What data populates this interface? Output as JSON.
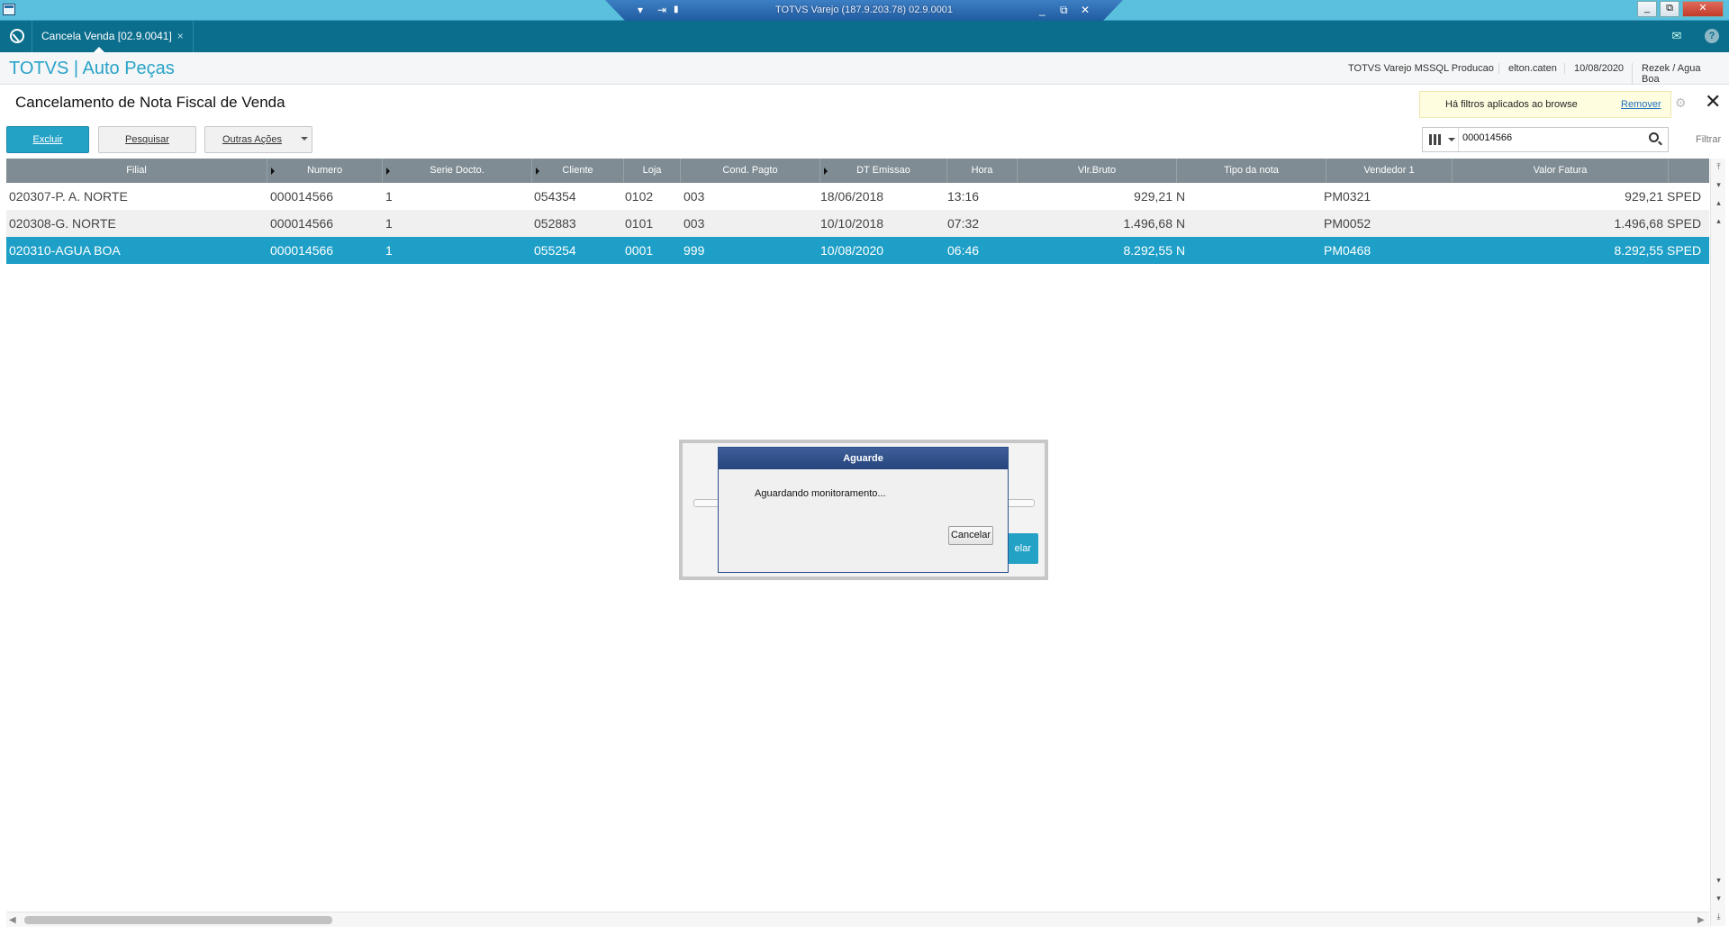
{
  "remote_session": {
    "title": "TOTVS Varejo (187.9.203.78) 02.9.0001",
    "ip": "187.9.203.78"
  },
  "window_controls": {
    "minimize": "_",
    "restore": "⧉",
    "close": "✕"
  },
  "app": {
    "tab_label": "Cancela Venda [02.9.0041]",
    "tab_close": "×",
    "brand": "TOTVS | Auto Peças",
    "environment": "TOTVS Varejo MSSQL Producao",
    "user": "elton.caten",
    "date": "10/08/2020",
    "branch": "Rezek / Agua Boa"
  },
  "page": {
    "title": "Cancelamento de Nota Fiscal de Venda",
    "filter_notice": "Há filtros aplicados ao browse",
    "filter_remove": "Remover"
  },
  "toolbar": {
    "excluir": "Excluir",
    "pesquisar": "Pesquisar",
    "outras_acoes": "Outras Ações",
    "search_value": "000014566",
    "filtrar": "Filtrar"
  },
  "grid": {
    "columns": [
      "Filial",
      "Numero",
      "Serie Docto.",
      "Cliente",
      "Loja",
      "Cond. Pagto",
      "DT Emissao",
      "Hora",
      "Vlr.Bruto",
      "Tipo da nota",
      "Vendedor 1",
      "Valor Fatura",
      ""
    ],
    "rows": [
      {
        "filial": "020307-P. A. NORTE",
        "numero": "000014566",
        "serie": "1",
        "cliente": "054354",
        "loja": "0102",
        "cond": "003",
        "dt": "18/06/2018",
        "hora": "13:16",
        "bruto": "929,21",
        "tipo": "N",
        "vendedor": "PM0321",
        "fatura": "929,21",
        "esp": "SPED"
      },
      {
        "filial": "020308-G. NORTE",
        "numero": "000014566",
        "serie": "1",
        "cliente": "052883",
        "loja": "0101",
        "cond": "003",
        "dt": "10/10/2018",
        "hora": "07:32",
        "bruto": "1.496,68",
        "tipo": "N",
        "vendedor": "PM0052",
        "fatura": "1.496,68",
        "esp": "SPED"
      },
      {
        "filial": "020310-AGUA BOA",
        "numero": "000014566",
        "serie": "1",
        "cliente": "055254",
        "loja": "0001",
        "cond": "999",
        "dt": "10/08/2020",
        "hora": "06:46",
        "bruto": "8.292,55",
        "tipo": "N",
        "vendedor": "PM0468",
        "fatura": "8.292,55",
        "esp": "SPED"
      }
    ],
    "selected_row": 2
  },
  "dialog": {
    "title": "Aguarde",
    "message": "Aguardando monitoramento...",
    "cancel": "Cancelar",
    "behind_button": "elar"
  },
  "colors": {
    "accent": "#23a2c6",
    "appbar": "#0b6e8d",
    "selected_row": "#1e9fc7",
    "header": "#7f8c93"
  }
}
